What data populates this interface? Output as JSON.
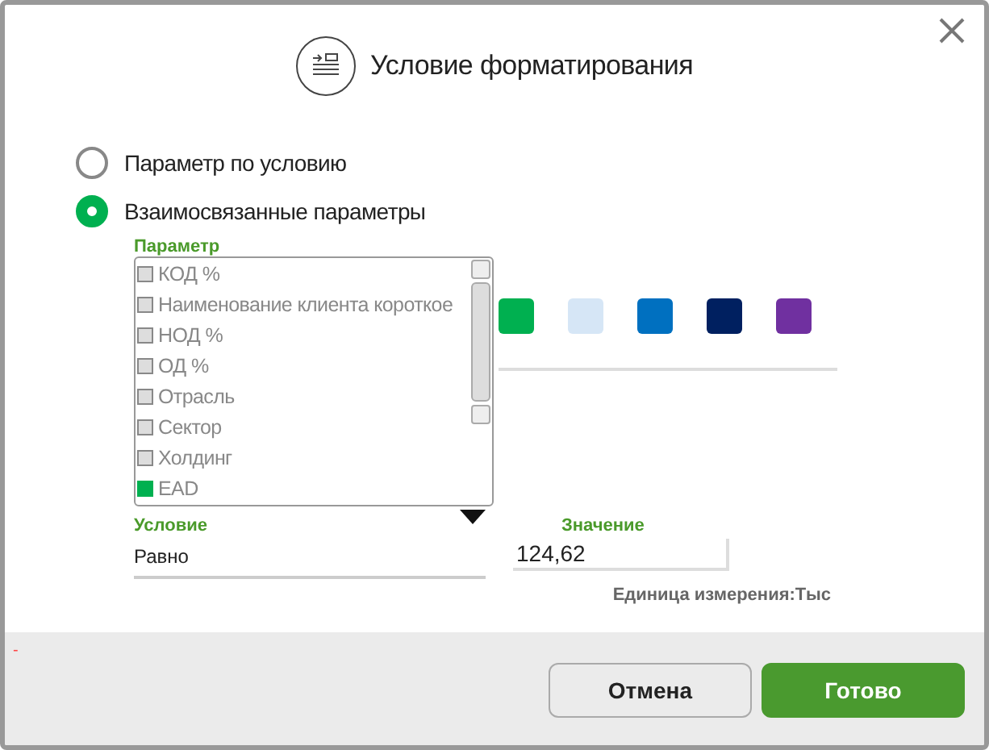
{
  "dialog": {
    "title": "Условие форматирования"
  },
  "radios": [
    {
      "label": "Параметр по условию",
      "selected": false
    },
    {
      "label": "Взаимосвязанные параметры",
      "selected": true
    }
  ],
  "parameter": {
    "label": "Параметр",
    "options": [
      {
        "label": "КОД %",
        "checked": false
      },
      {
        "label": "Наименование клиента короткое",
        "checked": false
      },
      {
        "label": "НОД %",
        "checked": false
      },
      {
        "label": "ОД %",
        "checked": false
      },
      {
        "label": "Отрасль",
        "checked": false
      },
      {
        "label": "Сектор",
        "checked": false
      },
      {
        "label": "Холдинг",
        "checked": false
      },
      {
        "label": "EAD",
        "checked": true
      }
    ]
  },
  "swatches": [
    {
      "color": "#00b050"
    },
    {
      "color": "#d6e6f6"
    },
    {
      "color": "#0070c0"
    },
    {
      "color": "#002060"
    },
    {
      "color": "#7030a0"
    }
  ],
  "condition": {
    "label": "Условие",
    "value": "Равно"
  },
  "value_field": {
    "label": "Значение",
    "value": "124,62"
  },
  "unit": "Единица измерения:Тыс",
  "error_mark": "-",
  "buttons": [
    {
      "label": "Отмена",
      "kind": "secondary"
    },
    {
      "label": "Готово",
      "kind": "primary"
    }
  ]
}
